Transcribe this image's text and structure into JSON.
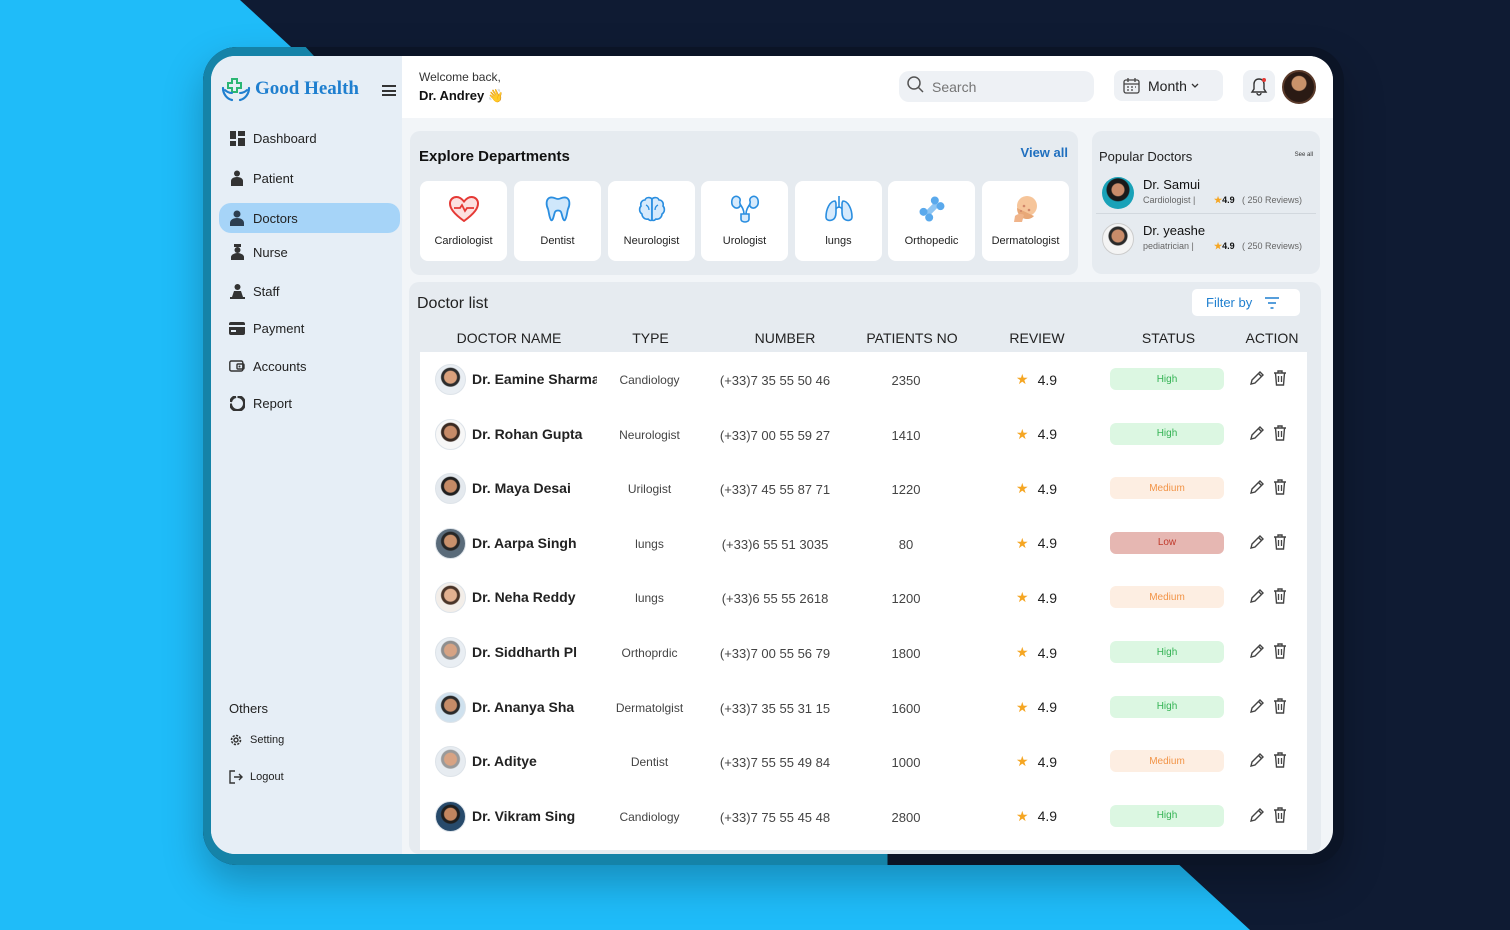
{
  "app": {
    "name": "Good Health",
    "brand_color": "#1f7fcf",
    "accent_color": "#a6d4f8"
  },
  "sidebar": {
    "items": [
      {
        "label": "Dashboard",
        "icon": "dashboard-icon"
      },
      {
        "label": "Patient",
        "icon": "patient-icon"
      },
      {
        "label": "Doctors",
        "icon": "doctors-icon",
        "active": true
      },
      {
        "label": "Nurse",
        "icon": "nurse-icon"
      },
      {
        "label": "Staff",
        "icon": "staff-icon"
      },
      {
        "label": "Payment",
        "icon": "payment-icon"
      },
      {
        "label": "Accounts",
        "icon": "accounts-icon"
      },
      {
        "label": "Report",
        "icon": "report-icon"
      }
    ],
    "others_label": "Others",
    "others": [
      {
        "label": "Setting",
        "icon": "gear-icon"
      },
      {
        "label": "Logout",
        "icon": "logout-icon"
      }
    ]
  },
  "header": {
    "welcome": "Welcome back,",
    "user": "Dr. Andrey 👋",
    "search_placeholder": "Search",
    "period": "Month"
  },
  "departments": {
    "title": "Explore Departments",
    "view_all": "View all",
    "items": [
      {
        "label": "Cardiologist",
        "icon": "heart-icon"
      },
      {
        "label": "Dentist",
        "icon": "tooth-icon"
      },
      {
        "label": "Neurologist",
        "icon": "brain-icon"
      },
      {
        "label": "Urologist",
        "icon": "kidney-icon"
      },
      {
        "label": "lungs",
        "icon": "lungs-icon"
      },
      {
        "label": "Orthopedic",
        "icon": "bone-icon"
      },
      {
        "label": "Dermatologist",
        "icon": "skin-icon"
      }
    ]
  },
  "popular": {
    "title": "Popular Doctors",
    "see_all": "See all",
    "doctors": [
      {
        "name": "Dr. Samui",
        "spec": "Cardiologist |",
        "rating": "4.9",
        "reviews": "( 250 Reviews)"
      },
      {
        "name": "Dr. yeashe",
        "spec": "pediatrician |",
        "rating": "4.9",
        "reviews": "( 250 Reviews)"
      }
    ]
  },
  "doctor_list": {
    "title": "Doctor list",
    "filter_label": "Filter by",
    "columns": [
      "DOCTOR NAME",
      "TYPE",
      "NUMBER",
      "PATIENTS NO",
      "REVIEW",
      "STATUS",
      "ACTION"
    ],
    "rows": [
      {
        "name": "Dr. Eamine Sharma",
        "type": "Candiology",
        "number": "(+33)7 35 55 50 46",
        "patients": "2350",
        "review": "4.9",
        "status": "High"
      },
      {
        "name": "Dr. Rohan Gupta",
        "type": "Neurologist",
        "number": "(+33)7 00 55 59 27",
        "patients": "1410",
        "review": "4.9",
        "status": "High"
      },
      {
        "name": "Dr. Maya Desai",
        "type": "Urilogist",
        "number": "(+33)7 45 55 87 71",
        "patients": "1220",
        "review": "4.9",
        "status": "Medium"
      },
      {
        "name": "Dr. Aarpa Singh",
        "type": "lungs",
        "number": "(+33)6 55 51 3035",
        "patients": "80",
        "review": "4.9",
        "status": "Low"
      },
      {
        "name": "Dr. Neha Reddy",
        "type": "lungs",
        "number": "(+33)6 55 55 2618",
        "patients": "1200",
        "review": "4.9",
        "status": "Medium"
      },
      {
        "name": "Dr. Siddharth Pl",
        "type": "Orthoprdic",
        "number": "(+33)7 00 55 56 79",
        "patients": "1800",
        "review": "4.9",
        "status": "High"
      },
      {
        "name": "Dr. Ananya Sha",
        "type": "Dermatolgist",
        "number": "(+33)7 35 55 31 15",
        "patients": "1600",
        "review": "4.9",
        "status": "High"
      },
      {
        "name": "Dr. Adityе",
        "type": "Dentist",
        "number": "(+33)7 55 55 49 84",
        "patients": "1000",
        "review": "4.9",
        "status": "Medium"
      },
      {
        "name": "Dr. Vikram Sing",
        "type": "Candiology",
        "number": "(+33)7 75 55 45 48",
        "patients": "2800",
        "review": "4.9",
        "status": "High"
      }
    ]
  }
}
